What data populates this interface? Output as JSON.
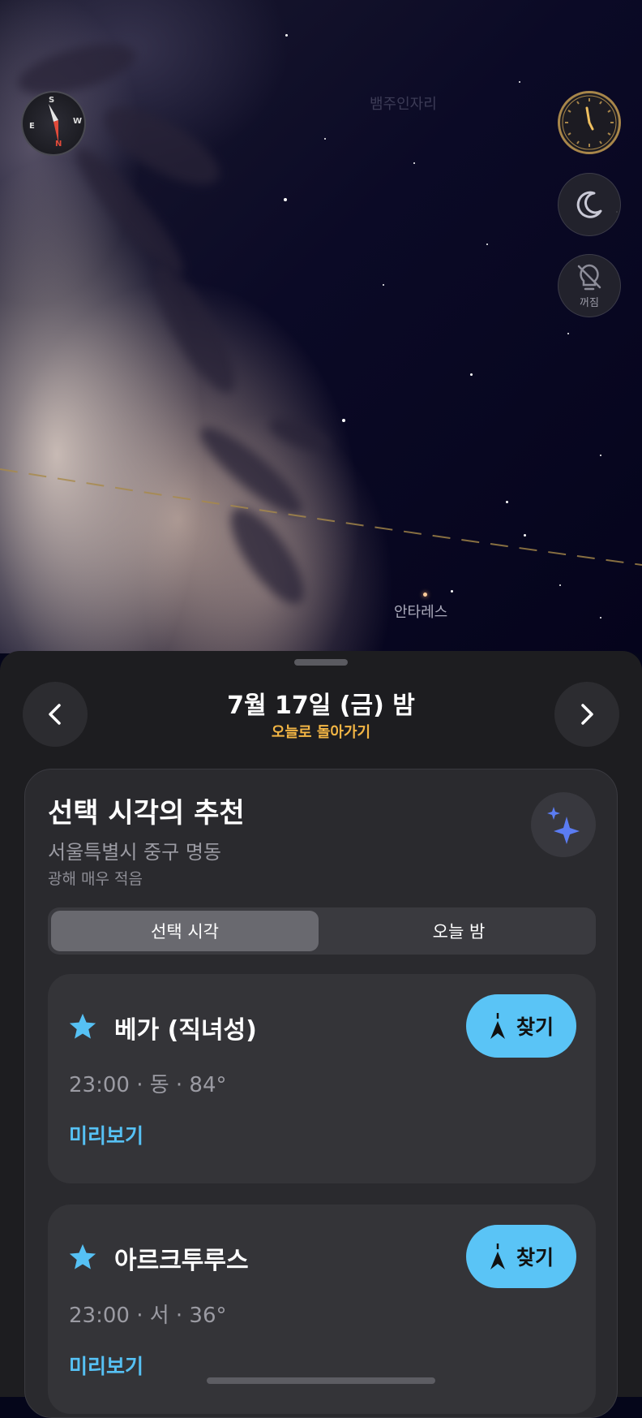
{
  "sky": {
    "constellation_label": "뱀주인자리",
    "star_label": "안타레스",
    "compass_letters": [
      "S",
      "W",
      "N",
      "E"
    ]
  },
  "controls": {
    "clock_icon": "clock-icon",
    "night_mode_icon": "moon-icon",
    "light_icon": "lightbulb-off-icon",
    "light_label": "꺼짐"
  },
  "header": {
    "date": "7월 17일 (금) 밤",
    "back_to_today": "오늘로 돌아가기"
  },
  "recommendation": {
    "title": "선택 시각의 추천",
    "location": "서울특별시 중구 명동",
    "light_pollution": "광해 매우 적음",
    "tabs": [
      {
        "label": "선택 시각",
        "active": true
      },
      {
        "label": "오늘 밤",
        "active": false
      }
    ],
    "items": [
      {
        "name": "베가 (직녀성)",
        "info": "23:00 · 동 · 84°",
        "find_label": "찾기",
        "preview_label": "미리보기"
      },
      {
        "name": "아르크투루스",
        "info": "23:00 · 서 · 36°",
        "find_label": "찾기",
        "preview_label": "미리보기"
      }
    ]
  },
  "colors": {
    "accent_blue": "#5ac4f6",
    "accent_gold": "#f2b544",
    "sheet_bg": "#1d1d20"
  }
}
